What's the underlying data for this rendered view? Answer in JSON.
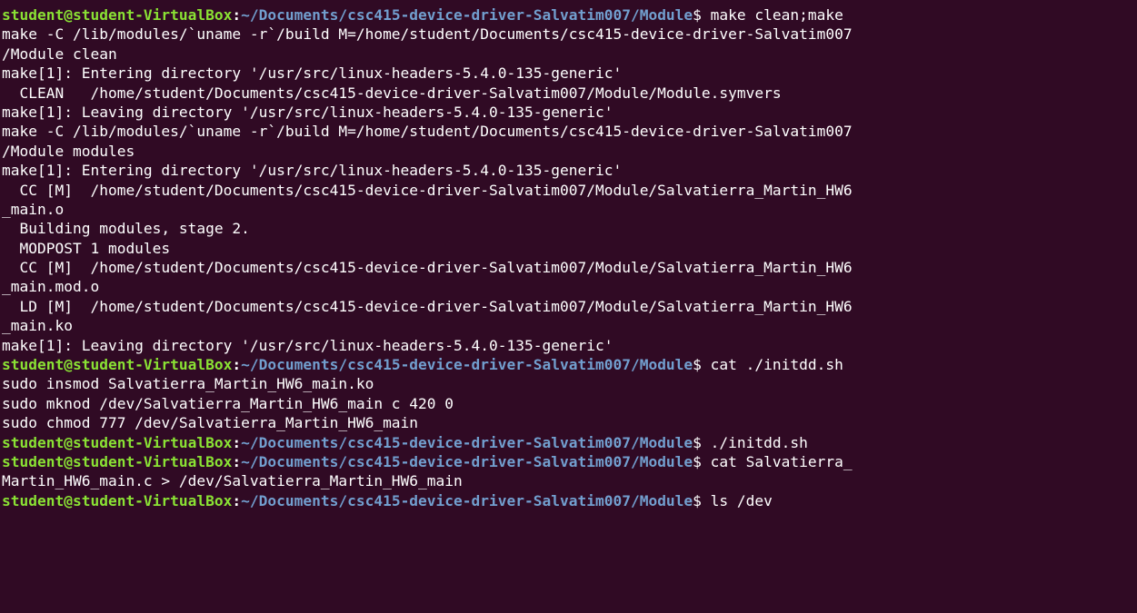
{
  "terminal": {
    "prompt": {
      "user_host": "student@student-VirtualBox",
      "separator": ":",
      "path": "~/Documents/csc415-device-driver-Salvatim007/Module",
      "symbol": "$ "
    },
    "lines": [
      {
        "type": "prompt",
        "command": "make clean;make"
      },
      {
        "type": "output",
        "text": "make -C /lib/modules/`uname -r`/build M=/home/student/Documents/csc415-device-driver-Salvatim007"
      },
      {
        "type": "output",
        "text": "/Module clean"
      },
      {
        "type": "output",
        "text": "make[1]: Entering directory '/usr/src/linux-headers-5.4.0-135-generic'"
      },
      {
        "type": "output",
        "text": "  CLEAN   /home/student/Documents/csc415-device-driver-Salvatim007/Module/Module.symvers"
      },
      {
        "type": "output",
        "text": "make[1]: Leaving directory '/usr/src/linux-headers-5.4.0-135-generic'"
      },
      {
        "type": "output",
        "text": "make -C /lib/modules/`uname -r`/build M=/home/student/Documents/csc415-device-driver-Salvatim007"
      },
      {
        "type": "output",
        "text": "/Module modules"
      },
      {
        "type": "output",
        "text": "make[1]: Entering directory '/usr/src/linux-headers-5.4.0-135-generic'"
      },
      {
        "type": "output",
        "text": "  CC [M]  /home/student/Documents/csc415-device-driver-Salvatim007/Module/Salvatierra_Martin_HW6"
      },
      {
        "type": "output",
        "text": "_main.o"
      },
      {
        "type": "output",
        "text": "  Building modules, stage 2."
      },
      {
        "type": "output",
        "text": "  MODPOST 1 modules"
      },
      {
        "type": "output",
        "text": "  CC [M]  /home/student/Documents/csc415-device-driver-Salvatim007/Module/Salvatierra_Martin_HW6"
      },
      {
        "type": "output",
        "text": "_main.mod.o"
      },
      {
        "type": "output",
        "text": "  LD [M]  /home/student/Documents/csc415-device-driver-Salvatim007/Module/Salvatierra_Martin_HW6"
      },
      {
        "type": "output",
        "text": "_main.ko"
      },
      {
        "type": "output",
        "text": "make[1]: Leaving directory '/usr/src/linux-headers-5.4.0-135-generic'"
      },
      {
        "type": "prompt",
        "command": "cat ./initdd.sh"
      },
      {
        "type": "output",
        "text": "sudo insmod Salvatierra_Martin_HW6_main.ko"
      },
      {
        "type": "output",
        "text": "sudo mknod /dev/Salvatierra_Martin_HW6_main c 420 0"
      },
      {
        "type": "output",
        "text": "sudo chmod 777 /dev/Salvatierra_Martin_HW6_main"
      },
      {
        "type": "prompt",
        "command": "./initdd.sh"
      },
      {
        "type": "prompt",
        "command": "cat Salvatierra_"
      },
      {
        "type": "output",
        "text": "Martin_HW6_main.c > /dev/Salvatierra_Martin_HW6_main"
      },
      {
        "type": "prompt",
        "command": "ls /dev"
      }
    ]
  }
}
